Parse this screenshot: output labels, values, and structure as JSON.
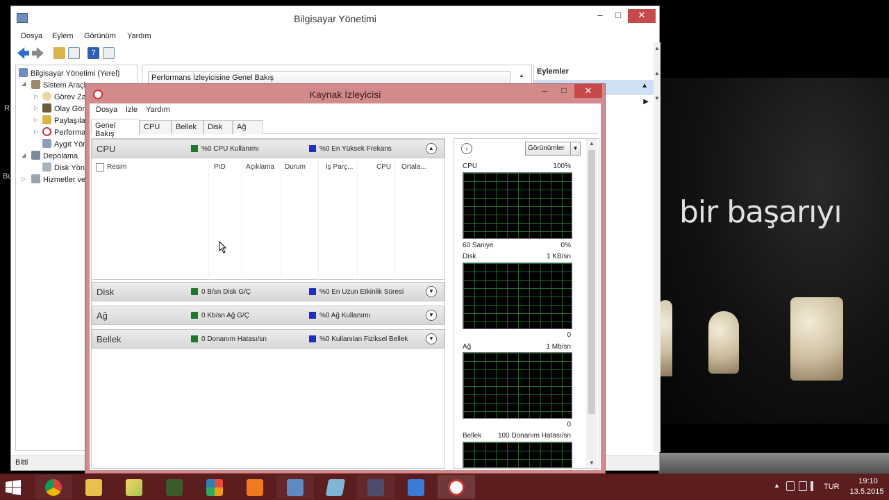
{
  "wallpaper": {
    "text": "bir başarıyı"
  },
  "computer_management": {
    "title": "Bilgisayar Yönetimi",
    "window_controls": {
      "minimize": "–",
      "maximize": "□",
      "close": "✕"
    },
    "menu": [
      "Dosya",
      "Eylem",
      "Görünüm",
      "Yardım"
    ],
    "tree": {
      "root": "Bilgisayar Yönetimi (Yerel)",
      "system_tools": "Sistem Araçları",
      "task_scheduler": "Görev Za",
      "event_viewer": "Olay Gör",
      "shared_folders": "Paylaşıla",
      "performance": "Performa",
      "device_manager": "Aygıt Yön",
      "storage": "Depolama",
      "disk_management": "Disk Yön",
      "services": "Hizmetler ve"
    },
    "center_header": "Performans İzleyicisine Genel Bakış",
    "actions_title": "Eylemler",
    "status": "Bitti",
    "edge_letters": [
      "R",
      "Bu"
    ]
  },
  "resource_monitor": {
    "title": "Kaynak İzleyicisi",
    "window_controls": {
      "minimize": "–",
      "maximize": "□",
      "close": "✕"
    },
    "menu": [
      "Dosya",
      "İzle",
      "Yardım"
    ],
    "tabs": [
      "Genel Bakış",
      "CPU",
      "Bellek",
      "Disk",
      "Ağ"
    ],
    "sections": {
      "cpu": {
        "title": "CPU",
        "label1": "%0 CPU Kullanımı",
        "label2": "%0 En Yüksek Frekans"
      },
      "disk": {
        "title": "Disk",
        "label1": "0 B/sn Disk G/Ç",
        "label2": "%0 En Uzun Etkinlik Süresi"
      },
      "network": {
        "title": "Ağ",
        "label1": "0 Kb/sn Ağ G/Ç",
        "label2": "%0 Ağ Kullanımı"
      },
      "memory": {
        "title": "Bellek",
        "label1": "0 Donanım Hatası/sn",
        "label2": "%0 Kullanılan Fiziksel Bellek"
      }
    },
    "cpu_table_columns": [
      "Resim",
      "PID",
      "Açıklama",
      "Durum",
      "İş Parç...",
      "CPU",
      "Ortala..."
    ],
    "views_button": "Görünümler",
    "graphs": {
      "cpu": {
        "name": "CPU",
        "max": "100%",
        "foot_left": "60 Saniye",
        "foot_right": "0%"
      },
      "disk": {
        "name": "Disk",
        "max": "1 KB/sn",
        "foot_right": "0"
      },
      "network": {
        "name": "Ağ",
        "max": "1 Mb/sn",
        "foot_right": "0"
      },
      "memory": {
        "name": "Bellek",
        "max": "100 Donanım Hatası/sn"
      }
    }
  },
  "taskbar": {
    "apps": [
      "chrome",
      "file-explorer",
      "folder",
      "minecraft",
      "office",
      "media-player",
      "computer-management",
      "notepad",
      "game",
      "remote-desktop",
      "resource-monitor"
    ],
    "tray": {
      "language": "TUR",
      "time": "19:10",
      "date": "13.5.2015"
    }
  }
}
